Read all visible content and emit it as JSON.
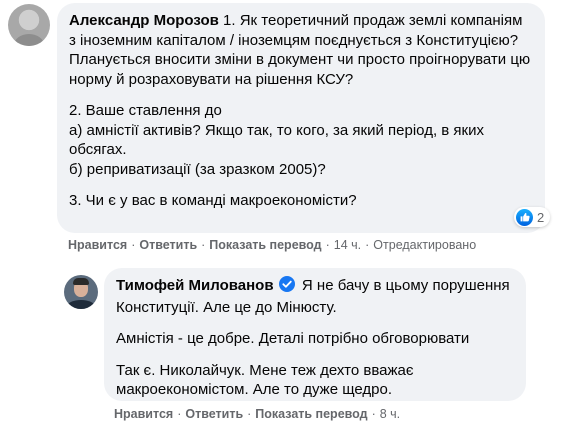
{
  "comment1": {
    "author": "Александр Морозов",
    "paragraphs": [
      "1. Як теоретичний продаж землі компаніям з іноземним капіталом / іноземцям поєднується з Конституцією? Планується вносити зміни в документ чи просто проігнорувати цю норму й розраховувати на рішення КСУ?",
      "2. Ваше ставлення до",
      "а) амністії активів? Якщо так, то кого, за який період, в яких обсягах.",
      "б) реприватизації (за зразком 2005)?",
      "3. Чи є у вас в команді макроекономісти?"
    ],
    "reaction_count": "2",
    "actions": {
      "like": "Нравится",
      "reply": "Ответить",
      "translate": "Показать перевод",
      "time": "14 ч.",
      "edited": "Отредактировано"
    }
  },
  "comment2": {
    "author": "Тимофей Милованов",
    "paragraphs": [
      "Я не бачу в цьому порушення Конституції. Але це до Мінюсту.",
      "Амністія - це добре. Деталі потрібно обговорювати",
      "Так є. Николайчук. Мене теж дехто вважає макроекономістом. Але то дуже щедро."
    ],
    "actions": {
      "like": "Нравится",
      "reply": "Ответить",
      "translate": "Показать перевод",
      "time": "8 ч."
    }
  },
  "colors": {
    "bubble": "#f0f2f5",
    "meta_text": "#65676b",
    "verified": "#1877f2"
  },
  "icons": {
    "like": "like-icon",
    "verified": "verified-badge-icon"
  }
}
